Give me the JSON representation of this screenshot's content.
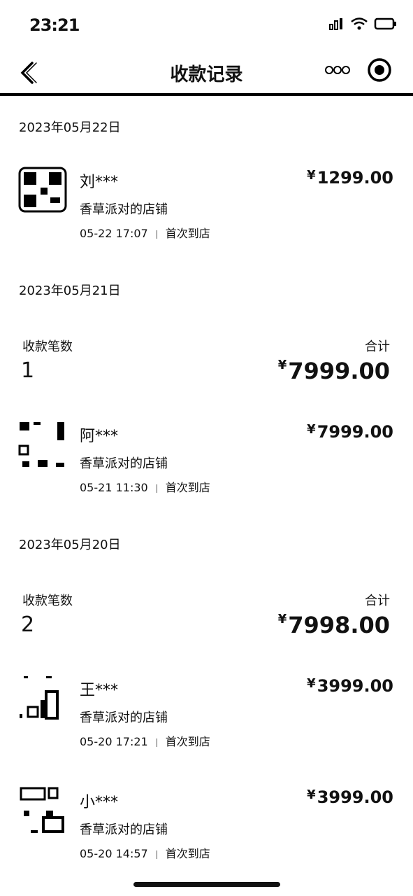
{
  "status_bar": {
    "time": "23:21"
  },
  "nav": {
    "title": "收款记录"
  },
  "groups": [
    {
      "date": "2023年05月22日",
      "records": [
        {
          "name": "刘***",
          "shop": "香草派对的店铺",
          "time": "05-22 17:07",
          "tag": "首次到店",
          "amount": "1299.00"
        }
      ]
    },
    {
      "date": "2023年05月21日",
      "summary": {
        "count_label": "收款笔数",
        "count": "1",
        "total_label": "合计",
        "total": "7999.00"
      },
      "records": [
        {
          "name": "阿***",
          "shop": "香草派对的店铺",
          "time": "05-21 11:30",
          "tag": "首次到店",
          "amount": "7999.00"
        }
      ]
    },
    {
      "date": "2023年05月20日",
      "summary": {
        "count_label": "收款笔数",
        "count": "2",
        "total_label": "合计",
        "total": "7998.00"
      },
      "records": [
        {
          "name": "王***",
          "shop": "香草派对的店铺",
          "time": "05-20 17:21",
          "tag": "首次到店",
          "amount": "3999.00"
        },
        {
          "name": "小***",
          "shop": "香草派对的店铺",
          "time": "05-20 14:57",
          "tag": "首次到店",
          "amount": "3999.00"
        }
      ]
    }
  ],
  "currency_symbol": "¥"
}
